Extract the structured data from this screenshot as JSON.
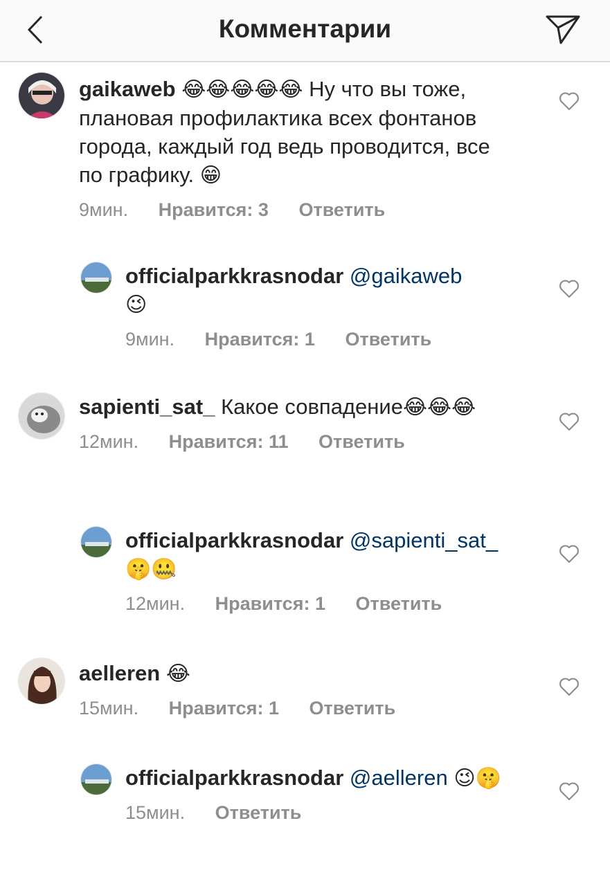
{
  "header": {
    "title": "Комментарии",
    "back_icon": "chevron-left-icon",
    "send_icon": "paper-plane-icon"
  },
  "colors": {
    "text": "#262626",
    "meta": "#8e8e8e",
    "mention": "#003569",
    "header_bg": "#fafafa"
  },
  "comments": [
    {
      "username": "gaikaweb",
      "text_emoji": "😂😂😂😂😂",
      "text": "Ну что вы тоже, плановая профилактика всех фонтанов города, каждый год ведь проводится, все по графику.",
      "text_end_emoji": "😁",
      "time": "9мин.",
      "likes": "Нравится: 3",
      "reply": "Ответить"
    },
    {
      "username": "officialparkkrasnodar",
      "mention": "@gaikaweb",
      "text_end_emoji": "😉",
      "time": "9мин.",
      "likes": "Нравится: 1",
      "reply": "Ответить"
    },
    {
      "username": "sapienti_sat_",
      "text": "Какое совпадение",
      "text_end_emoji": "😂😂😂",
      "time": "12мин.",
      "likes": "Нравится: 11",
      "reply": "Ответить"
    },
    {
      "username": "officialparkkrasnodar",
      "mention": "@sapienti_sat_",
      "text_end_emoji": "🤫🤐",
      "time": "12мин.",
      "likes": "Нравится: 1",
      "reply": "Ответить"
    },
    {
      "username": "aelleren",
      "text_end_emoji": "😂",
      "time": "15мин.",
      "likes": "Нравится: 1",
      "reply": "Ответить"
    },
    {
      "username": "officialparkkrasnodar",
      "mention": "@aelleren",
      "text_end_emoji": "😉🤫",
      "time": "15мин.",
      "reply": "Ответить"
    }
  ]
}
